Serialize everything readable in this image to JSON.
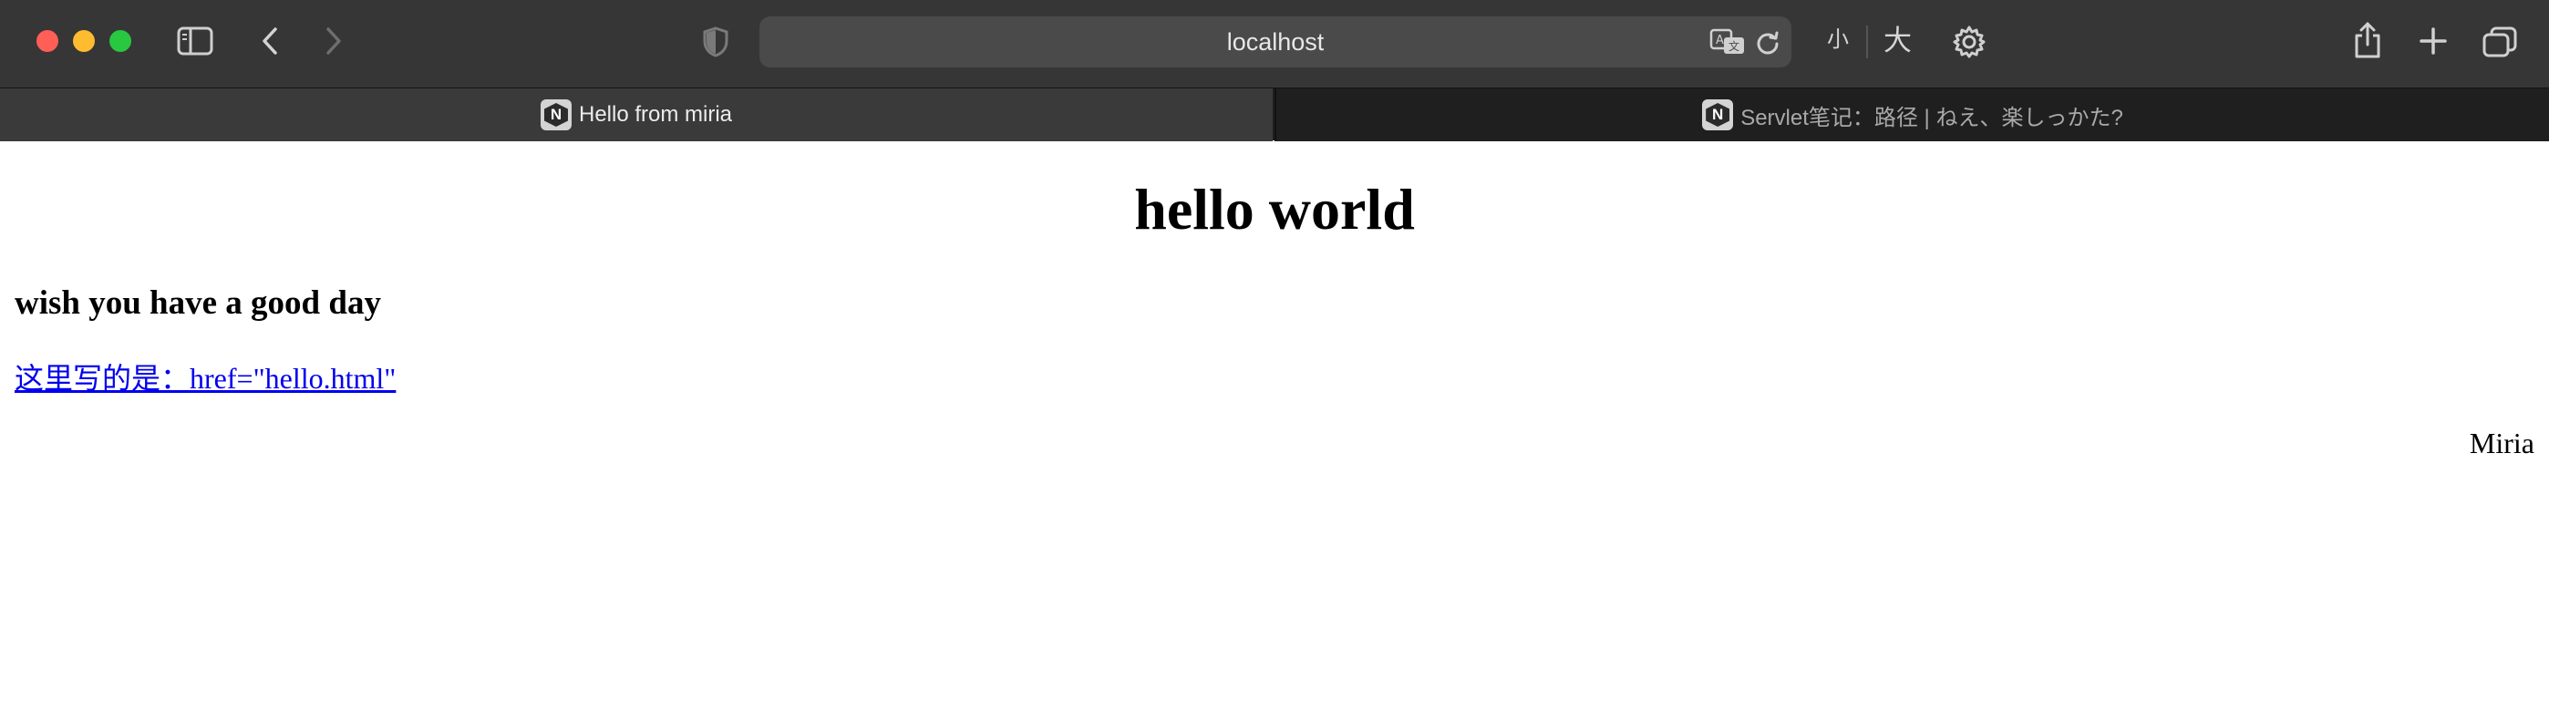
{
  "browser": {
    "address_bar": {
      "text": "localhost"
    },
    "toolbar": {
      "smaller_text_label": "小",
      "larger_text_label": "大"
    },
    "tabs": [
      {
        "title": "Hello from miria",
        "favicon_letter": "N",
        "active": true
      },
      {
        "title": "Servlet笔记：路径 | ねえ、楽しっかた?",
        "favicon_letter": "N",
        "active": false
      }
    ],
    "colors": {
      "close": "#ff5f57",
      "minimize": "#febc2e",
      "zoom": "#28c840"
    }
  },
  "page": {
    "heading": "hello world",
    "subheading": "wish you have a good day",
    "link_text": "这里写的是：href=\"hello.html\"",
    "signature": "Miria"
  }
}
